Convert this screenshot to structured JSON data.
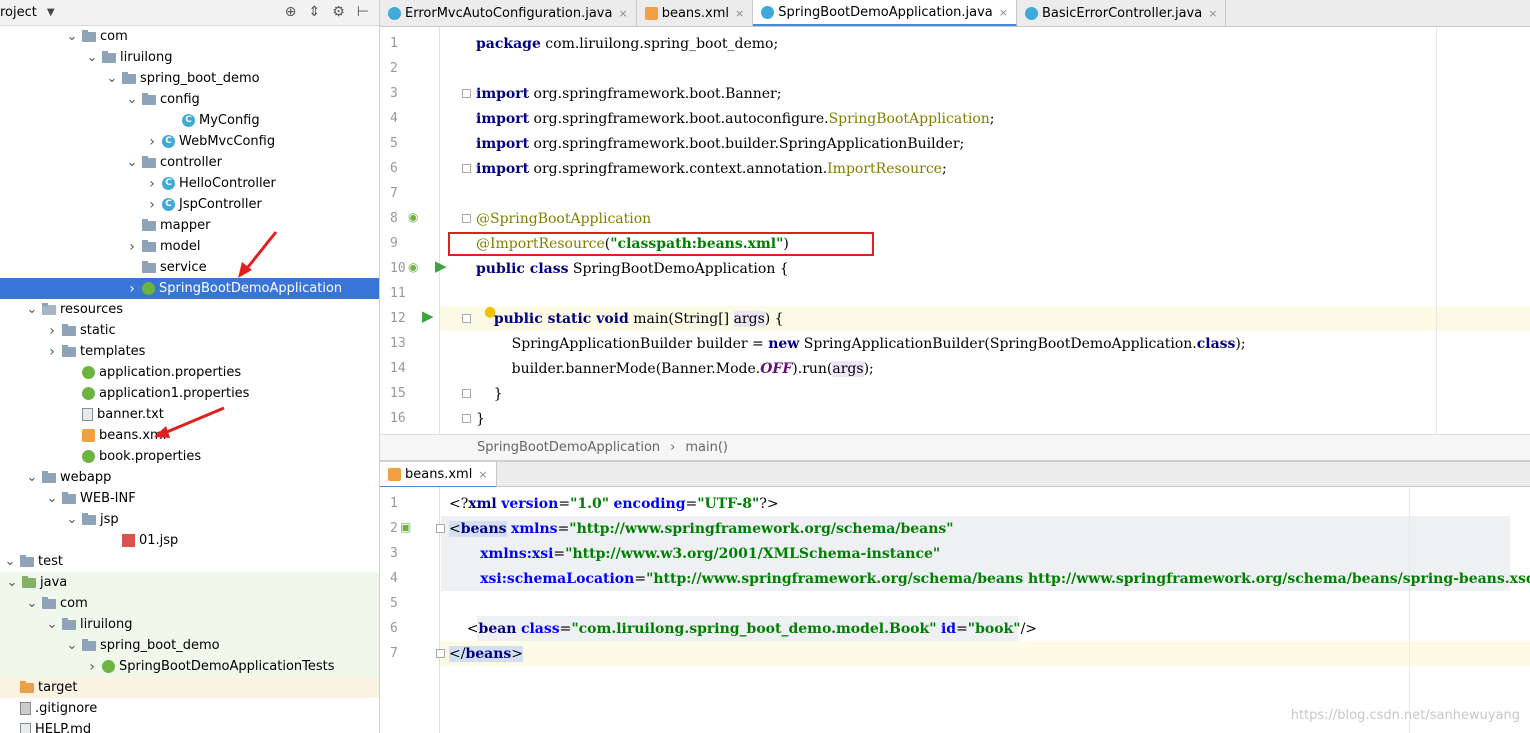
{
  "project": {
    "title": "roject",
    "tree": [
      {
        "label": "com",
        "depth": 4,
        "arrow": "open",
        "icon": "folder"
      },
      {
        "label": "liruilong",
        "depth": 5,
        "arrow": "open",
        "icon": "folder"
      },
      {
        "label": "spring_boot_demo",
        "depth": 6,
        "arrow": "open",
        "icon": "folder"
      },
      {
        "label": "config",
        "depth": 7,
        "arrow": "open",
        "icon": "folder"
      },
      {
        "label": "MyConfig",
        "depth": 9,
        "arrow": "none",
        "icon": "class"
      },
      {
        "label": "WebMvcConfig",
        "depth": 8,
        "arrow": "closed",
        "icon": "class"
      },
      {
        "label": "controller",
        "depth": 7,
        "arrow": "open",
        "icon": "folder"
      },
      {
        "label": "HelloController",
        "depth": 8,
        "arrow": "closed",
        "icon": "class"
      },
      {
        "label": "JspController",
        "depth": 8,
        "arrow": "closed",
        "icon": "class"
      },
      {
        "label": "mapper",
        "depth": 7,
        "arrow": "none",
        "icon": "folder"
      },
      {
        "label": "model",
        "depth": 7,
        "arrow": "closed",
        "icon": "folder"
      },
      {
        "label": "service",
        "depth": 7,
        "arrow": "none",
        "icon": "folder"
      },
      {
        "label": "SpringBootDemoApplication",
        "depth": 7,
        "arrow": "closed",
        "icon": "spring",
        "selected": true
      },
      {
        "label": "resources",
        "depth": 2,
        "arrow": "open",
        "icon": "folder-res"
      },
      {
        "label": "static",
        "depth": 3,
        "arrow": "closed",
        "icon": "folder"
      },
      {
        "label": "templates",
        "depth": 3,
        "arrow": "closed",
        "icon": "folder"
      },
      {
        "label": "application.properties",
        "depth": 4,
        "arrow": "none",
        "icon": "spring"
      },
      {
        "label": "application1.properties",
        "depth": 4,
        "arrow": "none",
        "icon": "spring"
      },
      {
        "label": "banner.txt",
        "depth": 4,
        "arrow": "none",
        "icon": "file"
      },
      {
        "label": "beans.xml",
        "depth": 4,
        "arrow": "none",
        "icon": "xml"
      },
      {
        "label": "book.properties",
        "depth": 4,
        "arrow": "none",
        "icon": "spring"
      },
      {
        "label": "webapp",
        "depth": 2,
        "arrow": "open",
        "icon": "folder"
      },
      {
        "label": "WEB-INF",
        "depth": 3,
        "arrow": "open",
        "icon": "folder"
      },
      {
        "label": "jsp",
        "depth": 4,
        "arrow": "open",
        "icon": "folder"
      },
      {
        "label": "01.jsp",
        "depth": 6,
        "arrow": "none",
        "icon": "jsp"
      },
      {
        "label": "test",
        "depth": 0,
        "arrow": "open",
        "icon": "folder"
      },
      {
        "label": "java",
        "depth": 1,
        "arrow": "open",
        "icon": "folder-green",
        "band": "green"
      },
      {
        "label": "com",
        "depth": 2,
        "arrow": "open",
        "icon": "folder",
        "band": "green"
      },
      {
        "label": "liruilong",
        "depth": 3,
        "arrow": "open",
        "icon": "folder",
        "band": "green"
      },
      {
        "label": "spring_boot_demo",
        "depth": 4,
        "arrow": "open",
        "icon": "folder",
        "band": "green"
      },
      {
        "label": "SpringBootDemoApplicationTests",
        "depth": 5,
        "arrow": "closed",
        "icon": "spring",
        "band": "green"
      },
      {
        "label": "target",
        "depth": 0,
        "arrow": "none",
        "icon": "folder-orange",
        "band": "orange"
      },
      {
        "label": ".gitignore",
        "depth": 0,
        "arrow": "none",
        "icon": "git"
      },
      {
        "label": "HELP.md",
        "depth": 0,
        "arrow": "none",
        "icon": "file"
      }
    ]
  },
  "tabs": [
    {
      "label": "ErrorMvcAutoConfiguration.java",
      "icon": "class",
      "active": false
    },
    {
      "label": "beans.xml",
      "icon": "xml",
      "active": false
    },
    {
      "label": "SpringBootDemoApplication.java",
      "icon": "class",
      "active": true
    },
    {
      "label": "BasicErrorController.java",
      "icon": "class",
      "active": false
    }
  ],
  "editor1": {
    "line_numbers": [
      "1",
      "2",
      "3",
      "4",
      "5",
      "6",
      "7",
      "8",
      "9",
      "10",
      "11",
      "12",
      "13",
      "14",
      "15",
      "16"
    ]
  },
  "breadcrumb": {
    "class_name": "SpringBootDemoApplication",
    "sep": "›",
    "method": "main()"
  },
  "editor2_tab": {
    "label": "beans.xml"
  },
  "editor2": {
    "line_numbers": [
      "1",
      "2",
      "3",
      "4",
      "5",
      "6",
      "7"
    ]
  },
  "watermark": "https://blog.csdn.net/sanhewuyang",
  "close_glyph": "×"
}
